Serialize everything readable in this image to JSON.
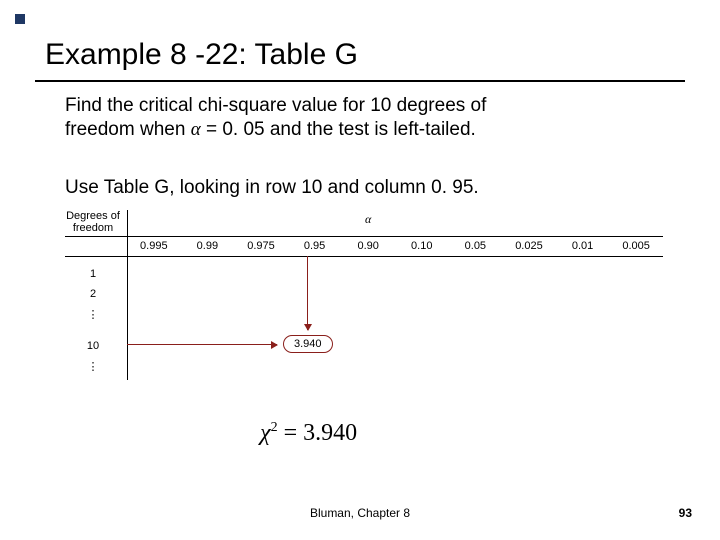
{
  "title": "Example 8 -22: Table G",
  "body": {
    "line1a": "Find the critical chi-square value for 10 degrees of",
    "line1b_prefix": "freedom when ",
    "alpha_symbol": "α",
    "line1b_suffix": " = 0. 05 and the test is left-tailed.",
    "line2": "Use Table G, looking in row 10 and column 0. 95."
  },
  "table": {
    "df_label_line1": "Degrees of",
    "df_label_line2": "freedom",
    "alpha_header": "α",
    "columns": [
      "0.995",
      "0.99",
      "0.975",
      "0.95",
      "0.90",
      "0.10",
      "0.05",
      "0.025",
      "0.01",
      "0.005"
    ],
    "df_rows": {
      "r1": "1",
      "r2": "2",
      "dots": "⋮",
      "r10": "10"
    },
    "highlighted_value": "3.940"
  },
  "equation": {
    "chi": "χ",
    "sup": "2",
    "rhs": " = 3.940"
  },
  "footer": {
    "center": "Bluman, Chapter 8",
    "page": "93"
  }
}
